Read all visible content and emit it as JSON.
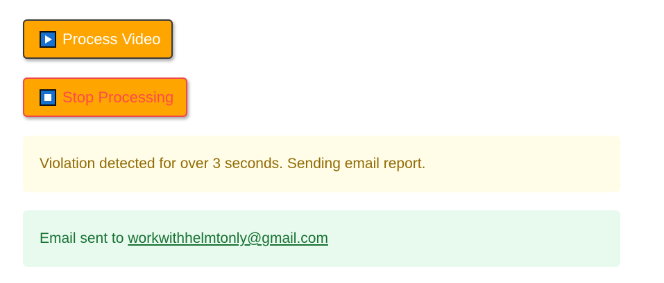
{
  "buttons": {
    "process_label": "Process Video",
    "stop_label": "Stop Processing"
  },
  "icons": {
    "process": "play-icon",
    "stop": "stop-icon"
  },
  "alerts": {
    "warning_text": "Violation detected for over 3 seconds. Sending email report.",
    "success_prefix": "Email sent to",
    "success_email": "workwithhelmtonly@gmail.com"
  },
  "colors": {
    "button_bg": "#ffa500",
    "stop_accent": "#ff4b4b",
    "icon_bg": "#1570cf",
    "warning_bg": "#fffce8",
    "warning_text": "#926c05",
    "success_bg": "#e8f9ee",
    "success_text": "#177233"
  }
}
